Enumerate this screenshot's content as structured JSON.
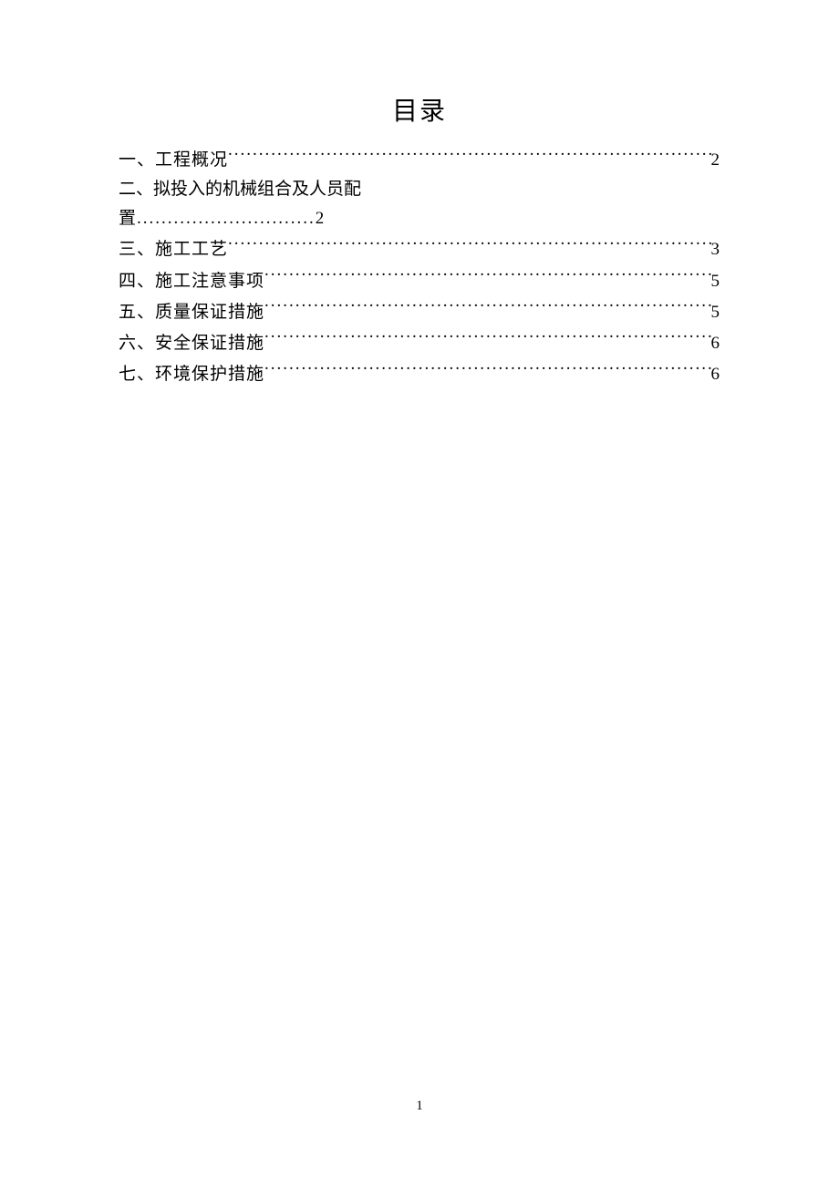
{
  "title": "目录",
  "toc": {
    "items": [
      {
        "label": "一、工程概况",
        "page": "2"
      },
      {
        "label": "二、拟投入的机械组合及人员配",
        "continuation": "置",
        "page": "2"
      },
      {
        "label": "三、施工工艺",
        "page": "3"
      },
      {
        "label": "四、施工注意事项",
        "page": "5"
      },
      {
        "label": "五、质量保证措施",
        "page": "5"
      },
      {
        "label": "六、安全保证措施",
        "page": "6"
      },
      {
        "label": "七、环境保护措施",
        "page": "6"
      }
    ]
  },
  "dots_short": ".............................",
  "page_number": "1"
}
